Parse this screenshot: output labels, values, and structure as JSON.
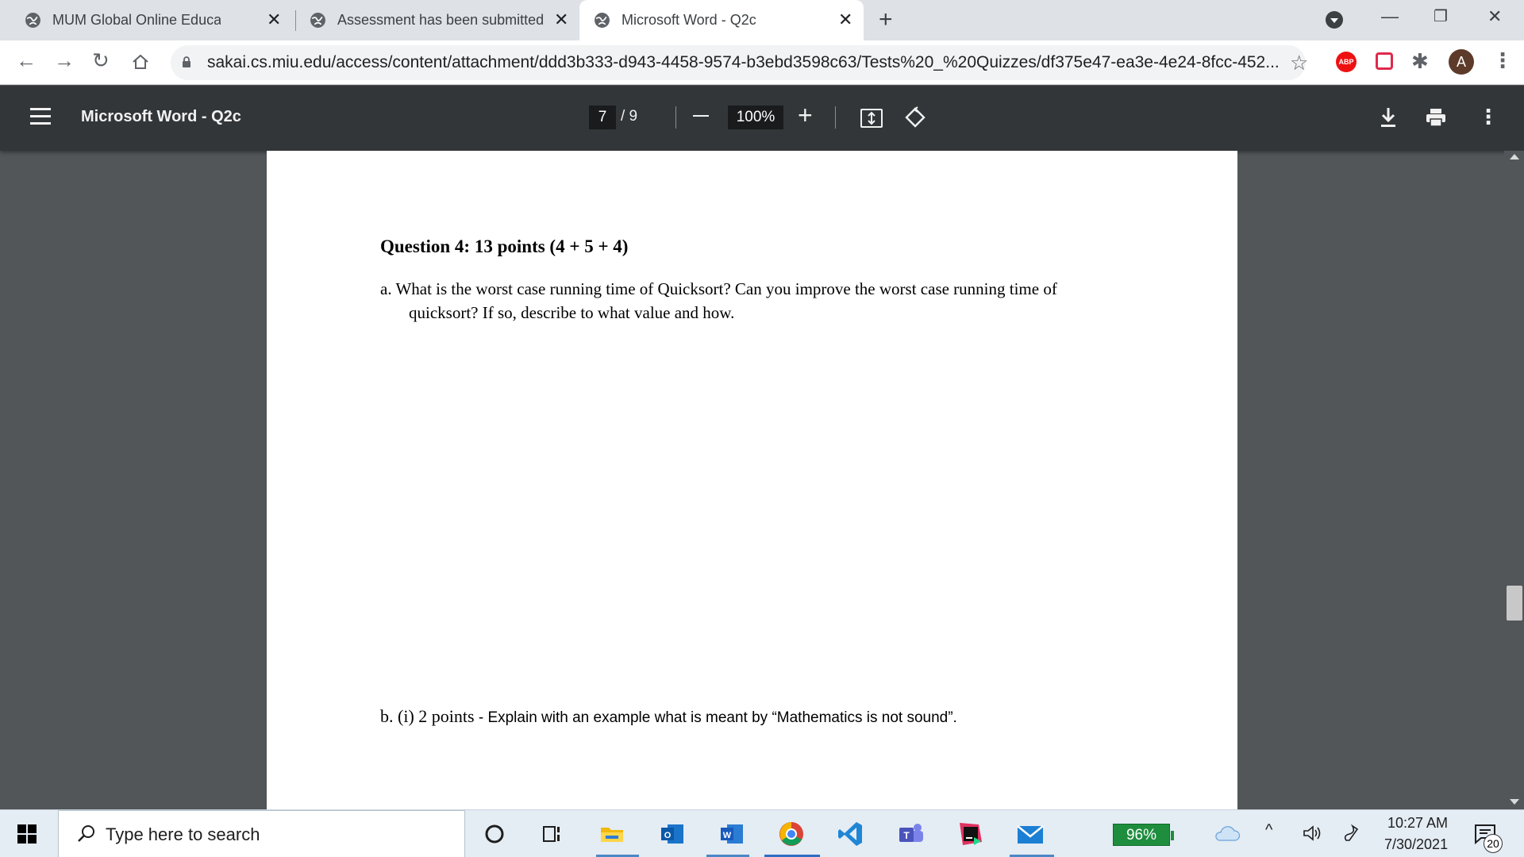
{
  "browser": {
    "tabs": [
      {
        "title": "MUM Global Online Education : C",
        "active": false
      },
      {
        "title": "Assessment has been submitted",
        "active": false
      },
      {
        "title": "Microsoft Word - Q2c",
        "active": true
      }
    ],
    "url": "sakai.cs.miu.edu/access/content/attachment/ddd3b333-d943-4458-9574-b3ebd3598c63/Tests%20_%20Quizzes/df375e47-ea3e-4e24-8fcc-452...",
    "profile_initial": "A",
    "extension_abp_label": "ABP"
  },
  "pdf_viewer": {
    "title": "Microsoft Word - Q2c",
    "current_page": "7",
    "total_pages": "/ 9",
    "zoom": "100%"
  },
  "document": {
    "question_title": "Question 4:  13 points  (4 + 5 + 4)",
    "part_a_line1": "a.  What is the worst case running time of Quicksort?  Can you improve the worst case running time of",
    "part_a_line2": "quicksort? If so, describe to what value and how.",
    "part_b_prefix": "b. (i)  2 points",
    "part_b_text": " - Explain with an example what is meant by “Mathematics is not sound”."
  },
  "taskbar": {
    "search_placeholder": "Type here to search",
    "battery": "96%",
    "time": "10:27 AM",
    "date": "7/30/2021",
    "notification_count": "20"
  },
  "colors": {
    "pdf_toolbar": "#323639",
    "viewer_background": "#525659",
    "battery_green": "#1e8e3e",
    "tab_strip": "#dee1e6"
  }
}
